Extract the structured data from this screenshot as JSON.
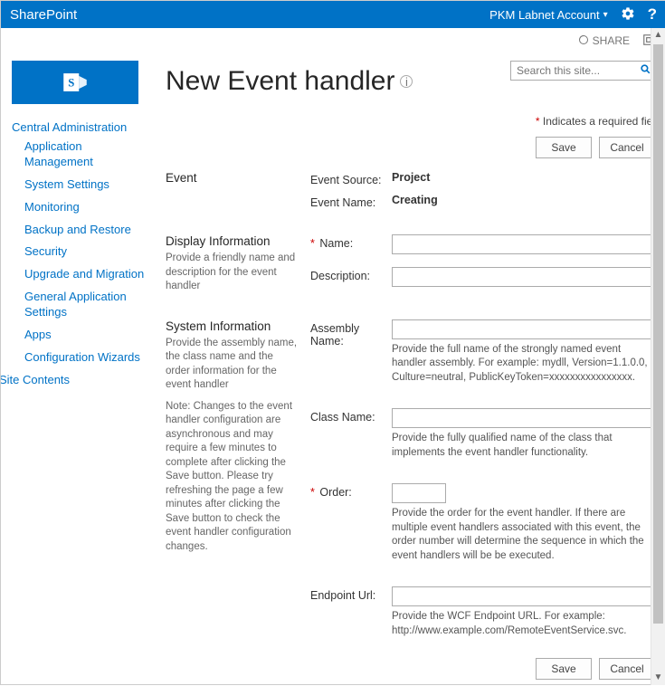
{
  "suite": {
    "brand": "SharePoint",
    "account": "PKM Labnet Account"
  },
  "ribbon": {
    "share": "SHARE"
  },
  "search": {
    "placeholder": "Search this site..."
  },
  "page": {
    "title": "New Event handler",
    "required_note": "Indicates a required fiel",
    "save": "Save",
    "cancel": "Cancel"
  },
  "nav": {
    "heading": "Central Administration",
    "items": [
      "Application Management",
      "System Settings",
      "Monitoring",
      "Backup and Restore",
      "Security",
      "Upgrade and Migration",
      "General Application Settings",
      "Apps",
      "Configuration Wizards"
    ],
    "site_contents": "Site Contents"
  },
  "sections": {
    "event": {
      "title": "Event",
      "source_label": "Event Source:",
      "source_value": "Project",
      "name_label": "Event Name:",
      "name_value": "Creating"
    },
    "display": {
      "title": "Display Information",
      "desc": "Provide a friendly name and description for the event handler",
      "name_label": "Name:",
      "desc_label": "Description:"
    },
    "system": {
      "title": "System Information",
      "desc": "Provide the assembly name, the class name and the order information for the event handler",
      "note": "Note: Changes to the event handler configuration are asynchronous and may require a few minutes to complete after clicking the Save button. Please try refreshing the page a few minutes after clicking the Save button to check the event handler configuration changes.",
      "assembly_label": "Assembly Name:",
      "assembly_help": "Provide the full name of the strongly named event handler assembly. For example: mydll, Version=1.1.0.0, Culture=neutral, PublicKeyToken=xxxxxxxxxxxxxxxx.",
      "class_label": "Class Name:",
      "class_help": "Provide the fully qualified name of the class that implements the event handler functionality.",
      "order_label": "Order:",
      "order_help": "Provide the order for the event handler. If there are multiple event handlers associated with this event, the order number will determine the sequence in which the event handlers will be be executed.",
      "endpoint_label": "Endpoint Url:",
      "endpoint_help": "Provide the WCF Endpoint URL. For example: http://www.example.com/RemoteEventService.svc."
    }
  }
}
